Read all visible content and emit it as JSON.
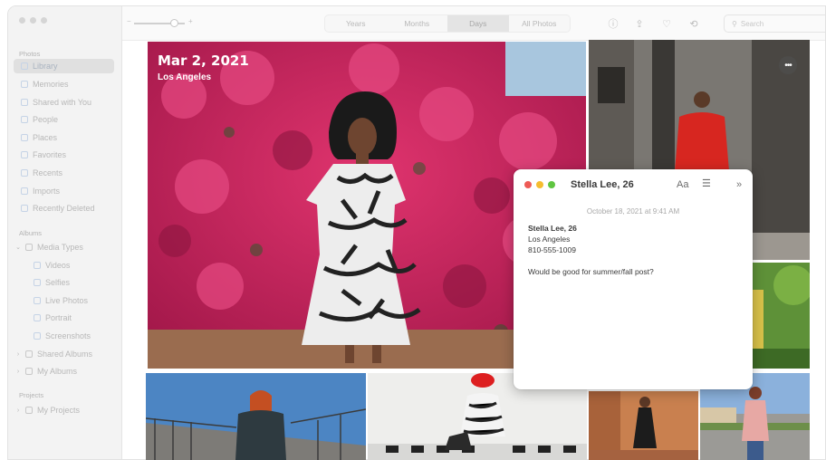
{
  "sidebar": {
    "photos_header": "Photos",
    "library": "Library",
    "memories": "Memories",
    "shared_with_you": "Shared with You",
    "people": "People",
    "places": "Places",
    "favorites": "Favorites",
    "recents": "Recents",
    "imports": "Imports",
    "recently_deleted": "Recently Deleted",
    "albums_header": "Albums",
    "media_types": "Media Types",
    "videos": "Videos",
    "selfies": "Selfies",
    "live_photos": "Live Photos",
    "portrait": "Portrait",
    "screenshots": "Screenshots",
    "shared_albums": "Shared Albums",
    "my_albums": "My Albums",
    "projects_header": "Projects",
    "my_projects": "My Projects"
  },
  "toolbar": {
    "tabs": [
      "Years",
      "Months",
      "Days",
      "All Photos"
    ],
    "active_tab": "Days",
    "search_placeholder": "Search",
    "zoom_min": "−",
    "zoom_max": "+",
    "icons": [
      "info-icon",
      "share-icon",
      "heart-icon",
      "rotate-icon"
    ]
  },
  "photo": {
    "date": "Mar 2, 2021",
    "location": "Los Angeles",
    "more": "•••"
  },
  "note": {
    "title": "Stella Lee, 26",
    "format_label": "Aa",
    "more_label": "»",
    "timestamp": "October 18, 2021 at 9:41 AM",
    "heading": "Stella Lee, 26",
    "line1": "Los Angeles",
    "line2": "810-555-1009",
    "comment": "Would be good for summer/fall post?"
  },
  "colors": {
    "close": "#ee5b56",
    "minimize": "#f5bd30",
    "zoom": "#5fc541",
    "bougainvillea": "#d4245e"
  }
}
